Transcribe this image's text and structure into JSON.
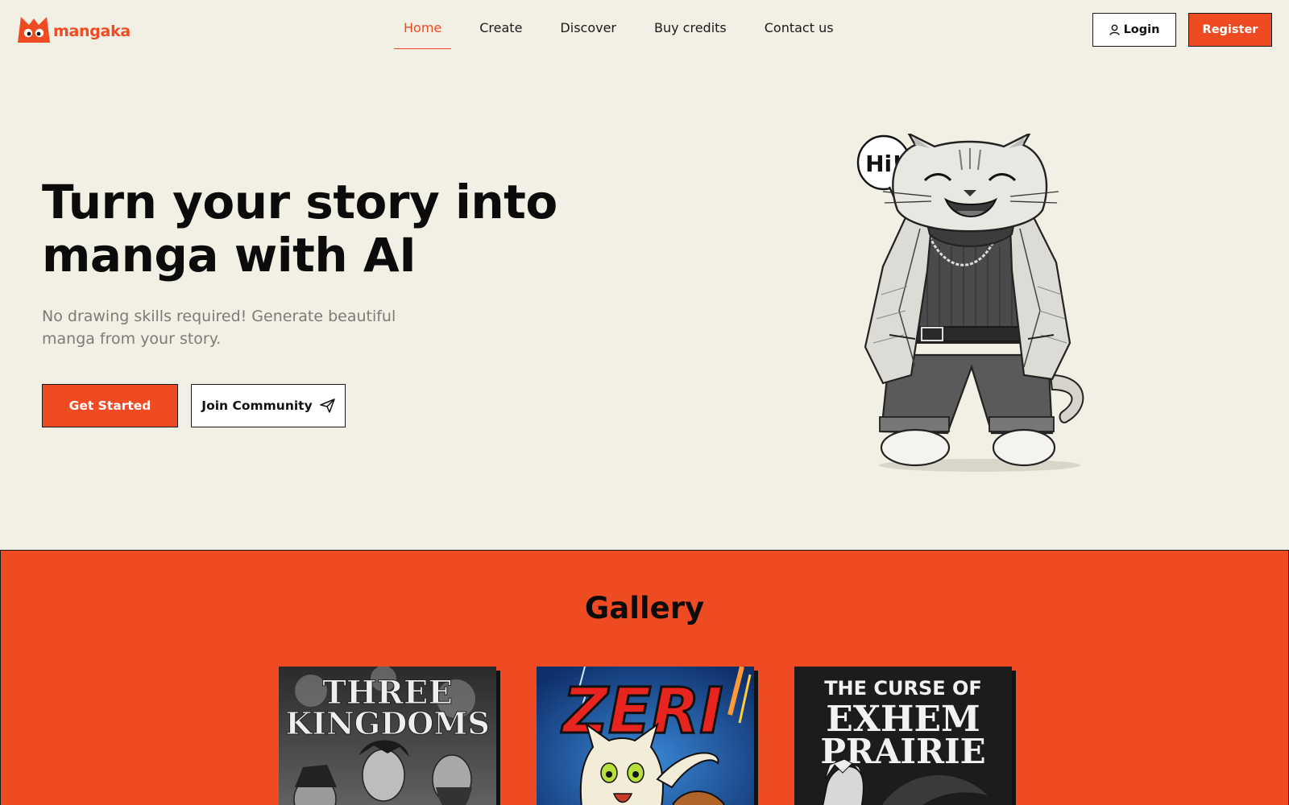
{
  "brand": {
    "name": "mangaka",
    "accent": "#ef4b23"
  },
  "nav": {
    "items": [
      {
        "label": "Home",
        "active": true
      },
      {
        "label": "Create",
        "active": false
      },
      {
        "label": "Discover",
        "active": false
      },
      {
        "label": "Buy credits",
        "active": false
      },
      {
        "label": "Contact us",
        "active": false
      }
    ]
  },
  "auth": {
    "login_label": "Login",
    "register_label": "Register"
  },
  "hero": {
    "title_line1": "Turn your story into",
    "title_line2": "manga with AI",
    "subtitle_line1": "No drawing skills required! Generate beautiful",
    "subtitle_line2": "manga from your story.",
    "cta_primary": "Get Started",
    "cta_secondary": "Join Community",
    "speech_bubble": "Hi!"
  },
  "gallery": {
    "title": "Gallery",
    "covers": [
      {
        "title_line1": "THREE",
        "title_line2": "KINGDOMS"
      },
      {
        "title_line1": "ZERI",
        "title_line2": ""
      },
      {
        "title_line1": "THE CURSE OF",
        "title_line2": "EXHEM",
        "title_line3": "PRAIRIE"
      }
    ]
  },
  "icons": {
    "login": "user-icon",
    "community": "paper-plane-icon",
    "logo": "cat-ears-m-logo"
  }
}
